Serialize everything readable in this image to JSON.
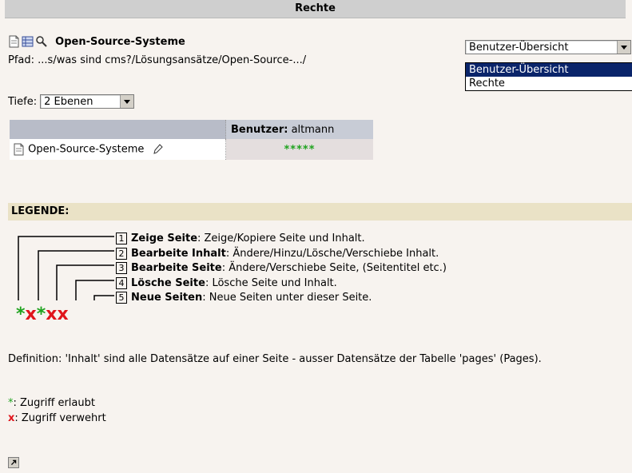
{
  "header": {
    "title": "Rechte"
  },
  "page": {
    "title": "Open-Source-Systeme",
    "path": "Pfad: ...s/was sind cms?/Lösungsansätze/Open-Source-.../"
  },
  "view_select": {
    "value": "Benutzer-Übersicht",
    "options": [
      "Benutzer-Übersicht",
      "Rechte"
    ]
  },
  "depth": {
    "label": "Tiefe:",
    "value": "2 Ebenen"
  },
  "table": {
    "user_label": "Benutzer:",
    "user_name": "altmann",
    "rows": [
      {
        "name": "Open-Source-Systeme",
        "perms": "*****"
      }
    ]
  },
  "legend": {
    "heading": "LEGENDE:",
    "items": [
      {
        "num": "1",
        "term": "Zeige Seite",
        "desc": ": Zeige/Kopiere Seite und Inhalt."
      },
      {
        "num": "2",
        "term": "Bearbeite Inhalt",
        "desc": ": Ändere/Hinzu/Lösche/Verschiebe Inhalt."
      },
      {
        "num": "3",
        "term": "Bearbeite Seite",
        "desc": ": Ändere/Verschiebe Seite, (Seitentitel etc.)"
      },
      {
        "num": "4",
        "term": "Lösche Seite",
        "desc": ": Lösche Seite und Inhalt."
      },
      {
        "num": "5",
        "term": "Neue Seiten",
        "desc": ": Neue Seiten unter dieser Seite."
      }
    ],
    "marks": [
      "*",
      "x",
      "*",
      "x",
      "x"
    ]
  },
  "definition": "Definition: 'Inhalt' sind alle Datensätze auf einer Seite - ausser Datensätze der Tabelle 'pages' (Pages).",
  "key": {
    "allowed_symbol": "*",
    "allowed_text": ": Zugriff erlaubt",
    "denied_symbol": "x",
    "denied_text": ": Zugriff verwehrt"
  },
  "colors": {
    "allowed": "#1fa31f",
    "denied": "#e0151c",
    "legend_bg": "#eae2c6",
    "title_bg": "#cfcfcf"
  }
}
